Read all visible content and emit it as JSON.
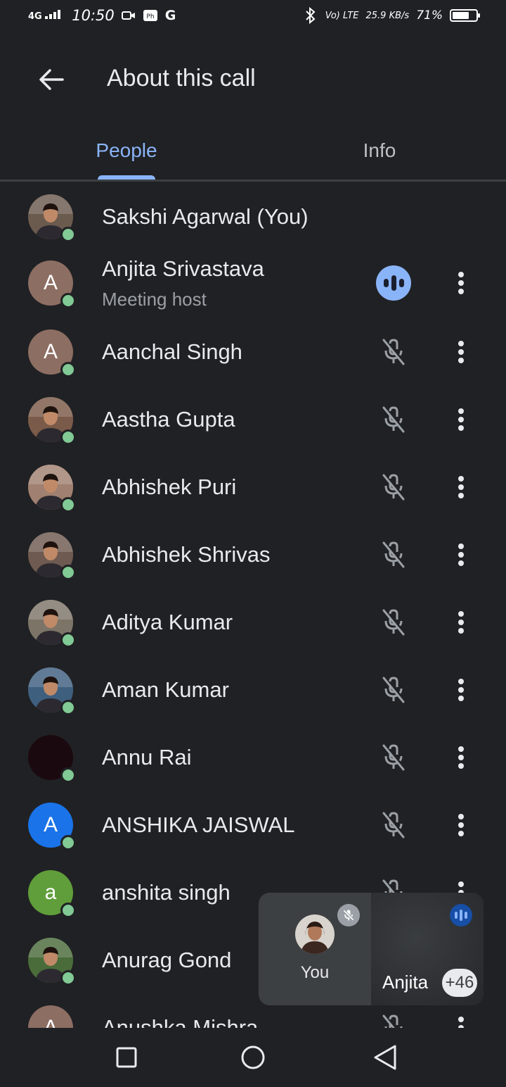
{
  "status_bar": {
    "signal": "4G",
    "time": "10:50",
    "app_g": "G",
    "volte": "Vo) LTE",
    "speed": "25.9",
    "speed_unit": "KB/s",
    "battery": "71%",
    "battery_level": 0.71
  },
  "header": {
    "title": "About this call",
    "back_icon": "arrow-back-icon"
  },
  "tabs": [
    {
      "label": "People",
      "active": true
    },
    {
      "label": "Info",
      "active": false
    }
  ],
  "participants": [
    {
      "name": "Sakshi Agarwal (You)",
      "subtitle": "",
      "initial": "",
      "avatar_color": "#6b5a4e",
      "photo": true,
      "mic": "none"
    },
    {
      "name": "Anjita Srivastava",
      "subtitle": "Meeting host",
      "initial": "A",
      "avatar_color": "#8d6e63",
      "photo": false,
      "mic": "speaking"
    },
    {
      "name": "Aanchal Singh",
      "subtitle": "",
      "initial": "A",
      "avatar_color": "#8d6e63",
      "photo": false,
      "mic": "muted"
    },
    {
      "name": "Aastha Gupta",
      "subtitle": "",
      "initial": "",
      "avatar_color": "#7a5a48",
      "photo": true,
      "mic": "muted"
    },
    {
      "name": "Abhishek Puri",
      "subtitle": "",
      "initial": "",
      "avatar_color": "#a08070",
      "photo": true,
      "mic": "muted"
    },
    {
      "name": "Abhishek Shrivas",
      "subtitle": "",
      "initial": "",
      "avatar_color": "#6e5a50",
      "photo": true,
      "mic": "muted"
    },
    {
      "name": "Aditya Kumar",
      "subtitle": "",
      "initial": "",
      "avatar_color": "#7d7468",
      "photo": true,
      "mic": "muted"
    },
    {
      "name": "Aman Kumar",
      "subtitle": "",
      "initial": "",
      "avatar_color": "#3f5f7f",
      "photo": true,
      "mic": "muted"
    },
    {
      "name": "Annu Rai",
      "subtitle": "",
      "initial": "",
      "avatar_color": "#1a0a0f",
      "photo": false,
      "mic": "muted"
    },
    {
      "name": "ANSHIKA JAISWAL",
      "subtitle": "",
      "initial": "A",
      "avatar_color": "#1a73e8",
      "photo": false,
      "mic": "muted"
    },
    {
      "name": "anshita singh",
      "subtitle": "",
      "initial": "a",
      "avatar_color": "#5f9e3a",
      "photo": false,
      "mic": "muted"
    },
    {
      "name": "Anurag Gond",
      "subtitle": "",
      "initial": "",
      "avatar_color": "#4a6b3a",
      "photo": true,
      "mic": "muted"
    },
    {
      "name": "Anushka Mishra",
      "subtitle": "",
      "initial": "A",
      "avatar_color": "#8d6e63",
      "photo": false,
      "mic": "muted"
    }
  ],
  "pip": {
    "self_label": "You",
    "other_label": "Anjita",
    "extra_count": "+46"
  }
}
